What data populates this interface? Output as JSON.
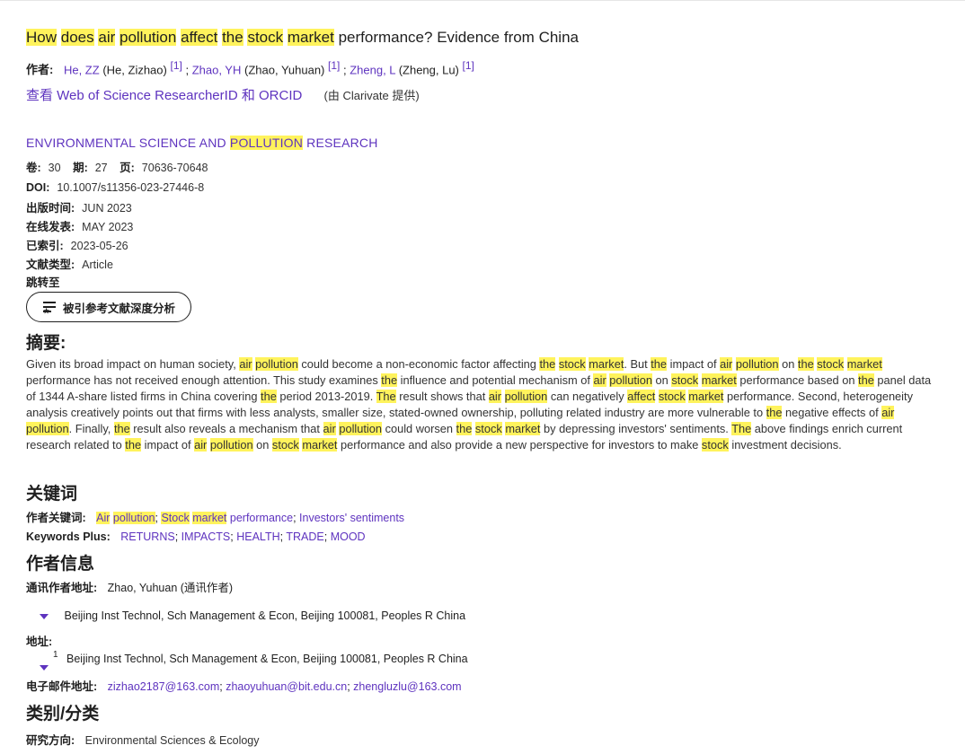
{
  "title": {
    "parts": [
      "How",
      "does",
      "air",
      "pollution",
      "affect",
      "the",
      "stock",
      "market"
    ],
    "rest": "performance? Evidence from China"
  },
  "authors": {
    "label": "作者:",
    "list": [
      {
        "abbr": "He, ZZ",
        "full": "(He, Zizhao)",
        "ref": "[1]"
      },
      {
        "abbr": "Zhao, YH",
        "full": "(Zhao, Yuhuan)",
        "ref": "[1]"
      },
      {
        "abbr": "Zheng, L",
        "full": "(Zheng, Lu)",
        "ref": "[1]"
      }
    ],
    "sep": " ;"
  },
  "researcher": {
    "link": "查看 Web of Science ResearcherID 和 ORCID",
    "provider": "(由 Clarivate 提供)"
  },
  "journal": {
    "before": "ENVIRONMENTAL SCIENCE AND ",
    "hl": "POLLUTION",
    "after": " RESEARCH"
  },
  "meta": {
    "vol_label": "卷:",
    "vol": "30",
    "issue_label": "期:",
    "issue": "27",
    "page_label": "页:",
    "pages": "70636-70648",
    "doi_label": "DOI:",
    "doi": "10.1007/s11356-023-27446-8",
    "pub_label": "出版时间:",
    "pub": "JUN 2023",
    "online_label": "在线发表:",
    "online": "MAY 2023",
    "indexed_label": "已索引:",
    "indexed": "2023-05-26",
    "type_label": "文献类型:",
    "type": "Article",
    "jump_label": "跳转至"
  },
  "button": {
    "label": "被引参考文献深度分析",
    "icon": "list-star-icon"
  },
  "abstract": {
    "heading": "摘要:",
    "text": "Given its broad impact on human society, air pollution could become a non-economic factor affecting the stock market. But the impact of air pollution on the stock market performance has not received enough attention. This study examines the influence and potential mechanism of air pollution on stock market performance based on the panel data of 1344 A-share listed firms in China covering the period 2013-2019. The result shows that air pollution can negatively affect stock market performance. Second, heterogeneity analysis creatively points out that firms with less analysts, smaller size, stated-owned ownership, polluting related industry are more vulnerable to the negative effects of air pollution. Finally, the result also reveals a mechanism that air pollution could worsen the stock market by depressing investors' sentiments. The above findings enrich current research related to the impact of air pollution on stock market performance and also provide a new perspective for investors to make stock investment decisions."
  },
  "keywords": {
    "heading": "关键词",
    "author_label": "作者关键词:",
    "plus_label": "Keywords Plus:",
    "plus": [
      "RETURNS",
      "IMPACTS",
      "HEALTH",
      "TRADE",
      "MOOD"
    ],
    "investors": "Investors' sentiments",
    "performance": "performance"
  },
  "author_info": {
    "heading": "作者信息",
    "corr_label": "通讯作者地址:",
    "corr_name": "Zhao, Yuhuan",
    "corr_tag": "(通讯作者)",
    "corr_addr": "Beijing Inst Technol, Sch Management & Econ, Beijing 100081, Peoples R China",
    "addr_label": "地址:",
    "addr_num": "1",
    "addr": "Beijing Inst Technol, Sch Management & Econ, Beijing 100081, Peoples R China",
    "email_label": "电子邮件地址:",
    "emails": [
      "zizhao2187@163.com",
      "zhaoyuhuan@bit.edu.cn",
      "zhengluzlu@163.com"
    ]
  },
  "category": {
    "heading": "类别/分类",
    "research_label": "研究方向:",
    "research": "Environmental Sciences & Ecology"
  },
  "colors": {
    "highlight": "#fff35c",
    "link": "#5e33bf"
  }
}
